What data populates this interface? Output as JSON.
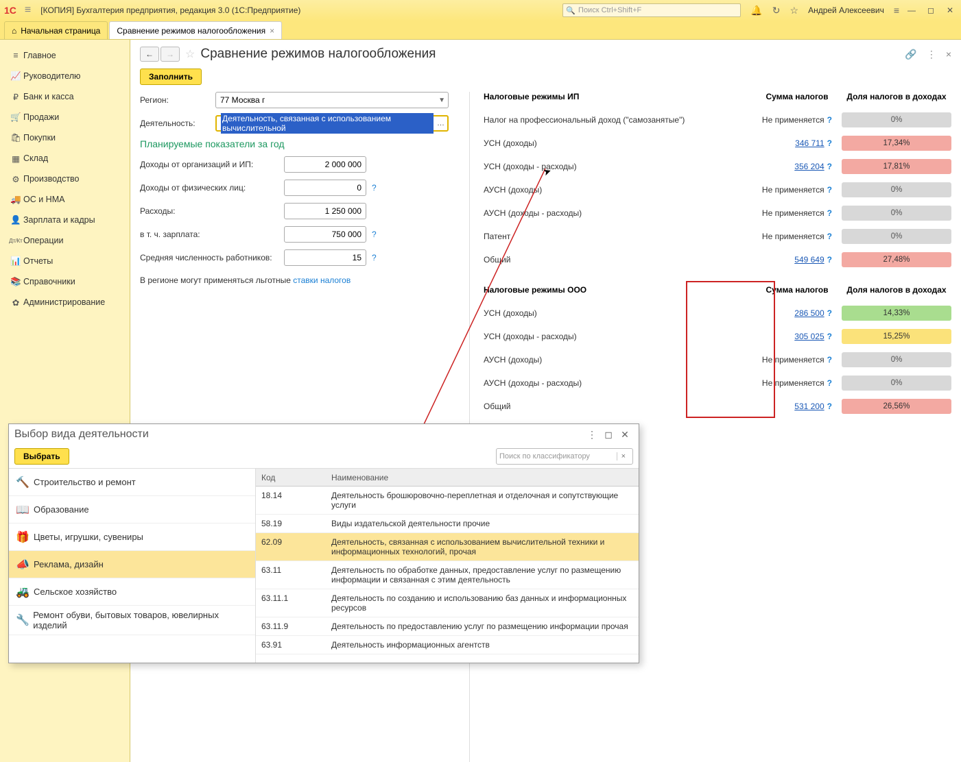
{
  "titlebar": {
    "logo": "1C",
    "app_title": "[КОПИЯ] Бухгалтерия предприятия, редакция 3.0  (1С:Предприятие)",
    "search_placeholder": "Поиск Ctrl+Shift+F",
    "user": "Андрей Алексеевич"
  },
  "tabs": {
    "home": "Начальная страница",
    "current": "Сравнение режимов налогообложения"
  },
  "sidebar": [
    {
      "icon": "≡",
      "label": "Главное"
    },
    {
      "icon": "📈",
      "label": "Руководителю"
    },
    {
      "icon": "₽",
      "label": "Банк и касса"
    },
    {
      "icon": "🛒",
      "label": "Продажи"
    },
    {
      "icon": "🛍",
      "label": "Покупки"
    },
    {
      "icon": "▦",
      "label": "Склад"
    },
    {
      "icon": "⚙",
      "label": "Производство"
    },
    {
      "icon": "🚚",
      "label": "ОС и НМА"
    },
    {
      "icon": "👤",
      "label": "Зарплата и кадры"
    },
    {
      "icon": "Дт/Кт",
      "label": "Операции"
    },
    {
      "icon": "📊",
      "label": "Отчеты"
    },
    {
      "icon": "📚",
      "label": "Справочники"
    },
    {
      "icon": "✿",
      "label": "Администрирование"
    }
  ],
  "page": {
    "title": "Сравнение режимов налогообложения",
    "fill_button": "Заполнить",
    "region_label": "Регион:",
    "region_value": "77 Москва г",
    "activity_label": "Деятельность:",
    "activity_value": "Деятельность, связанная с использованием вычислительной",
    "planned_header": "Планируемые показатели за год",
    "income_org_label": "Доходы от организаций и ИП:",
    "income_org_value": "2 000 000",
    "income_phys_label": "Доходы от физических лиц:",
    "income_phys_value": "0",
    "expenses_label": "Расходы:",
    "expenses_value": "1 250 000",
    "salary_label": "в т. ч. зарплата:",
    "salary_value": "750 000",
    "emp_label": "Средняя численность работников:",
    "emp_value": "15",
    "footnote_text": "В регионе могут применяться льготные ",
    "footnote_link": "ставки налогов"
  },
  "right": {
    "hdr_ip": "Налоговые режимы ИП",
    "hdr_ooo": "Налоговые режимы ООО",
    "sum_label": "Сумма налогов",
    "share_label": "Доля налогов в доходах",
    "na": "Не применяется",
    "ip_rows": [
      {
        "name": "Налог на профессиональный доход (\"самозанятые\")",
        "val": "na",
        "bar": "gray",
        "pct": "0%"
      },
      {
        "name": "УСН (доходы)",
        "val": "346 711",
        "link": true,
        "bar": "red",
        "pct": "17,34%"
      },
      {
        "name": "УСН (доходы - расходы)",
        "val": "356 204",
        "link": true,
        "bar": "red",
        "pct": "17,81%"
      },
      {
        "name": "АУСН (доходы)",
        "val": "na",
        "bar": "gray",
        "pct": "0%"
      },
      {
        "name": "АУСН (доходы - расходы)",
        "val": "na",
        "bar": "gray",
        "pct": "0%"
      },
      {
        "name": "Патент",
        "val": "na",
        "bar": "gray",
        "pct": "0%"
      },
      {
        "name": "Общий",
        "val": "549 649",
        "link": true,
        "bar": "red",
        "pct": "27,48%"
      }
    ],
    "ooo_rows": [
      {
        "name": "УСН (доходы)",
        "val": "286 500",
        "link": true,
        "bar": "green",
        "pct": "14,33%"
      },
      {
        "name": "УСН (доходы - расходы)",
        "val": "305 025",
        "link": true,
        "bar": "yellow",
        "pct": "15,25%"
      },
      {
        "name": "АУСН (доходы)",
        "val": "na",
        "bar": "gray",
        "pct": "0%"
      },
      {
        "name": "АУСН (доходы - расходы)",
        "val": "na",
        "bar": "gray",
        "pct": "0%"
      },
      {
        "name": "Общий",
        "val": "531 200",
        "link": true,
        "bar": "red",
        "pct": "26,56%"
      }
    ]
  },
  "popup": {
    "title": "Выбор вида деятельности",
    "choose": "Выбрать",
    "search_placeholder": "Поиск по классификатору",
    "categories": [
      {
        "icon": "🔨",
        "label": "Строительство и ремонт"
      },
      {
        "icon": "📖",
        "label": "Образование"
      },
      {
        "icon": "🎁",
        "label": "Цветы, игрушки, сувениры"
      },
      {
        "icon": "📣",
        "label": "Реклама, дизайн",
        "sel": true
      },
      {
        "icon": "🚜",
        "label": "Сельское хозяйство"
      },
      {
        "icon": "🔧",
        "label": "Ремонт обуви, бытовых товаров, ювелирных изделий"
      }
    ],
    "table_headers": {
      "code": "Код",
      "name": "Наименование"
    },
    "rows": [
      {
        "code": "18.14",
        "name": "Деятельность брошюровочно-переплетная и отделочная и сопутствующие услуги"
      },
      {
        "code": "58.19",
        "name": "Виды издательской деятельности прочие"
      },
      {
        "code": "62.09",
        "name": "Деятельность, связанная с использованием вычислительной техники и информационных технологий, прочая",
        "sel": true
      },
      {
        "code": "63.11",
        "name": "Деятельность по обработке данных, предоставление услуг по размещению информации и связанная с этим деятельность"
      },
      {
        "code": "63.11.1",
        "name": "Деятельность по созданию и использованию баз данных и информационных ресурсов"
      },
      {
        "code": "63.11.9",
        "name": "Деятельность по предоставлению услуг по размещению информации прочая"
      },
      {
        "code": "63.91",
        "name": "Деятельность информационных агентств"
      }
    ]
  }
}
